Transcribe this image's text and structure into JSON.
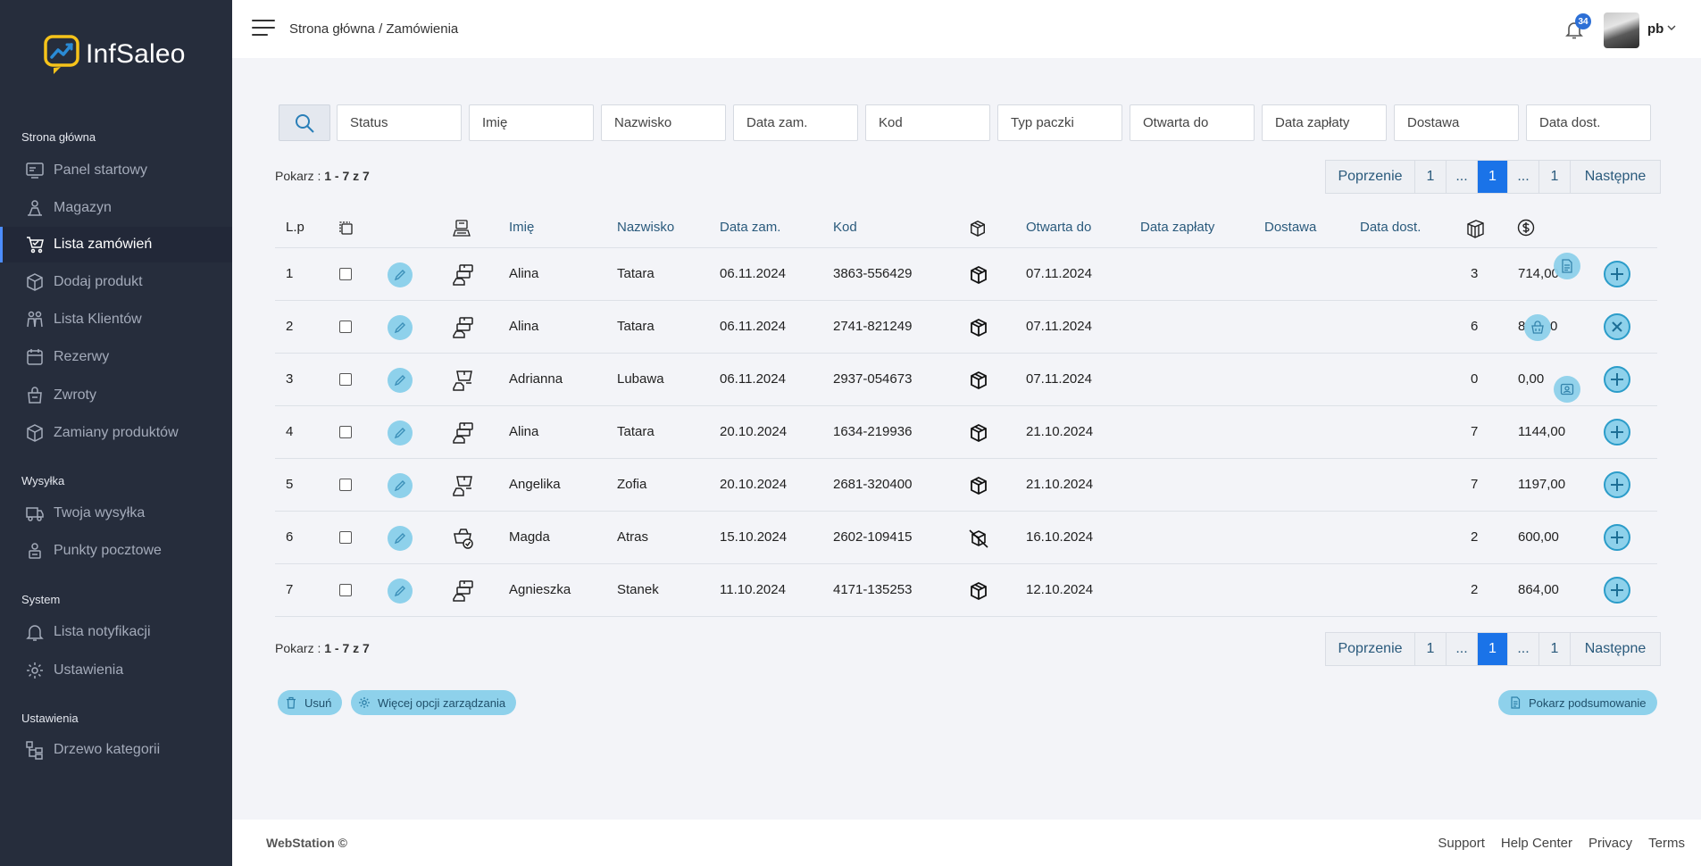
{
  "brand": {
    "name": "InfSaleo"
  },
  "sidebar": {
    "sections": [
      {
        "title": "Strona główna"
      },
      {
        "title": "Wysyłka"
      },
      {
        "title": "System"
      },
      {
        "title": "Ustawienia"
      }
    ],
    "items": [
      {
        "label": "Panel startowy",
        "icon": "dashboard-icon"
      },
      {
        "label": "Magazyn",
        "icon": "warehouse-icon"
      },
      {
        "label": "Lista zamówień",
        "icon": "cart-icon",
        "active": true
      },
      {
        "label": "Dodaj produkt",
        "icon": "box-icon"
      },
      {
        "label": "Lista Klientów",
        "icon": "clients-icon"
      },
      {
        "label": "Rezerwy",
        "icon": "reserve-icon"
      },
      {
        "label": "Zwroty",
        "icon": "returns-icon"
      },
      {
        "label": "Zamiany produktów",
        "icon": "exchange-icon"
      },
      {
        "label": "Twoja wysyłka",
        "icon": "truck-icon"
      },
      {
        "label": "Punkty pocztowe",
        "icon": "post-point-icon"
      },
      {
        "label": "Lista notyfikacji",
        "icon": "notification-list-icon"
      },
      {
        "label": "Ustawienia",
        "icon": "settings-icon"
      },
      {
        "label": "Drzewo kategorii",
        "icon": "category-tree-icon"
      }
    ]
  },
  "header": {
    "breadcrumb": "Strona główna / Zamówienia",
    "notifications": "34",
    "user": "pb"
  },
  "filters": [
    "Status",
    "Imię",
    "Nazwisko",
    "Data zam.",
    "Kod",
    "Typ paczki",
    "Otwarta do",
    "Data zapłaty",
    "Dostawa",
    "Data dost."
  ],
  "summary": {
    "prefix": "Pokarz : ",
    "range": "1 - 7 z 7"
  },
  "pagination": {
    "prev": "Poprzenie",
    "first": "1",
    "dots": "...",
    "current": "1",
    "dots2": "...",
    "last": "1",
    "next": "Następne"
  },
  "table": {
    "headers": {
      "lp": "L.p",
      "imie": "Imię",
      "nazwisko": "Nazwisko",
      "data_zam": "Data zam.",
      "kod": "Kod",
      "otwarta": "Otwarta do",
      "data_zaplaty": "Data zapłaty",
      "dostawa": "Dostawa",
      "data_dost": "Data dost."
    },
    "rows": [
      {
        "lp": "1",
        "imie": "Alina",
        "nazwisko": "Tatara",
        "data_zam": "06.11.2024",
        "kod": "3863-556429",
        "otwarta": "07.11.2024",
        "qty": "3",
        "amount": "714,00",
        "type_icon": "parcels-stack-icon",
        "box_icon": "box-icon",
        "action": "plus"
      },
      {
        "lp": "2",
        "imie": "Alina",
        "nazwisko": "Tatara",
        "data_zam": "06.11.2024",
        "kod": "2741-821249",
        "otwarta": "07.11.2024",
        "qty": "6",
        "amount": "8",
        "amount_tail": "0",
        "type_icon": "parcels-stack-icon",
        "box_icon": "box-icon",
        "action": "close"
      },
      {
        "lp": "3",
        "imie": "Adrianna",
        "nazwisko": "Lubawa",
        "data_zam": "06.11.2024",
        "kod": "2937-054673",
        "otwarta": "07.11.2024",
        "qty": "0",
        "amount": "0,00",
        "type_icon": "parcel-courier-icon",
        "box_icon": "box-icon",
        "action": "plus"
      },
      {
        "lp": "4",
        "imie": "Alina",
        "nazwisko": "Tatara",
        "data_zam": "20.10.2024",
        "kod": "1634-219936",
        "otwarta": "21.10.2024",
        "qty": "7",
        "amount": "1144,00",
        "type_icon": "parcels-stack-icon",
        "box_icon": "box-icon",
        "action": "plus"
      },
      {
        "lp": "5",
        "imie": "Angelika",
        "nazwisko": "Zofia",
        "data_zam": "20.10.2024",
        "kod": "2681-320400",
        "otwarta": "21.10.2024",
        "qty": "7",
        "amount": "1197,00",
        "type_icon": "parcel-courier-icon",
        "box_icon": "box-icon",
        "action": "plus"
      },
      {
        "lp": "6",
        "imie": "Magda",
        "nazwisko": "Atras",
        "data_zam": "15.10.2024",
        "kod": "2602-109415",
        "otwarta": "16.10.2024",
        "qty": "2",
        "amount": "600,00",
        "type_icon": "basket-check-icon",
        "box_icon": "box-crossed-icon",
        "action": "plus"
      },
      {
        "lp": "7",
        "imie": "Agnieszka",
        "nazwisko": "Stanek",
        "data_zam": "11.10.2024",
        "kod": "4171-135253",
        "otwarta": "12.10.2024",
        "qty": "2",
        "amount": "864,00",
        "type_icon": "parcels-stack-icon",
        "box_icon": "box-icon",
        "action": "plus"
      }
    ]
  },
  "actions": {
    "delete": "Usuń",
    "more": "Więcej opcji zarządzania",
    "summary": "Pokarz podsumowanie"
  },
  "footer": {
    "brand": "WebStation ©",
    "links": [
      "Support",
      "Help Center",
      "Privacy",
      "Terms"
    ]
  },
  "colors": {
    "sidebar": "#262d3c",
    "accent": "#1a73e8",
    "button": "#8ed1eb",
    "link": "#2a5a7c"
  }
}
